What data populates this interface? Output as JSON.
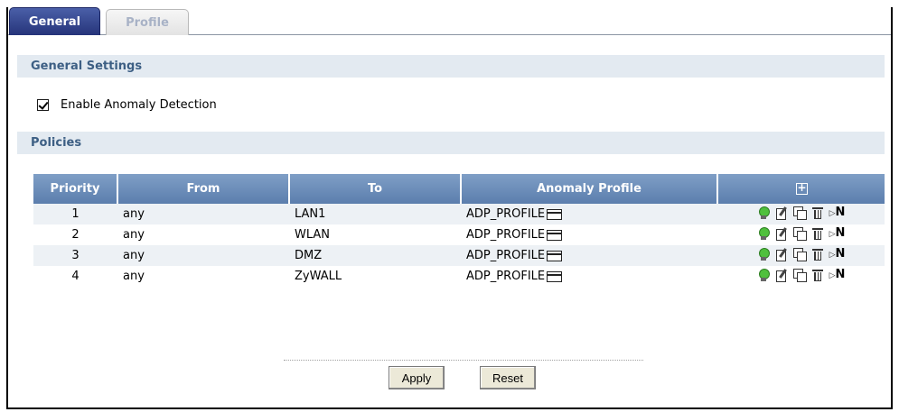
{
  "tabs": [
    {
      "label": "General",
      "active": true
    },
    {
      "label": "Profile",
      "active": false
    }
  ],
  "general_settings": {
    "title": "General Settings",
    "enable_anomaly_detection": {
      "label": "Enable Anomaly Detection",
      "checked": true
    }
  },
  "policies": {
    "title": "Policies",
    "columns": [
      "Priority",
      "From",
      "To",
      "Anomaly Profile"
    ],
    "add_icon": "add-icon",
    "rows": [
      {
        "priority": "1",
        "from": "any",
        "to": "LAN1",
        "profile": "ADP_PROFILE"
      },
      {
        "priority": "2",
        "from": "any",
        "to": "WLAN",
        "profile": "ADP_PROFILE"
      },
      {
        "priority": "3",
        "from": "any",
        "to": "DMZ",
        "profile": "ADP_PROFILE"
      },
      {
        "priority": "4",
        "from": "any",
        "to": "ZyWALL",
        "profile": "ADP_PROFILE"
      }
    ],
    "row_actions": [
      "status-bulb-icon",
      "edit-icon",
      "clone-icon",
      "delete-icon",
      "move-icon"
    ],
    "move_label": "N"
  },
  "buttons": {
    "apply": "Apply",
    "reset": "Reset"
  },
  "colors": {
    "active_tab": "#26347a",
    "header": "#6b8cb8",
    "section_bar": "#e3eaf1",
    "status_on": "#4fc03c"
  }
}
